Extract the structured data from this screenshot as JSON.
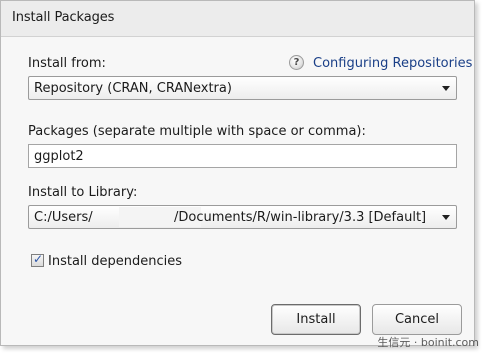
{
  "window": {
    "title": "Install Packages"
  },
  "install_from": {
    "label": "Install from:",
    "help_icon": "?",
    "help_link": "Configuring Repositories",
    "selected": "Repository (CRAN, CRANextra)"
  },
  "packages": {
    "label": "Packages (separate multiple with space or comma):",
    "value": "ggplot2"
  },
  "library": {
    "label": "Install to Library:",
    "path_start": "C:/Users/",
    "path_end": "/Documents/R/win-library/3.3 [Default]"
  },
  "dependencies": {
    "label": "Install dependencies",
    "checked": true,
    "check_glyph": "✓"
  },
  "buttons": {
    "install": "Install",
    "cancel": "Cancel"
  },
  "watermark": {
    "text": "生信元 · boinit.com"
  }
}
